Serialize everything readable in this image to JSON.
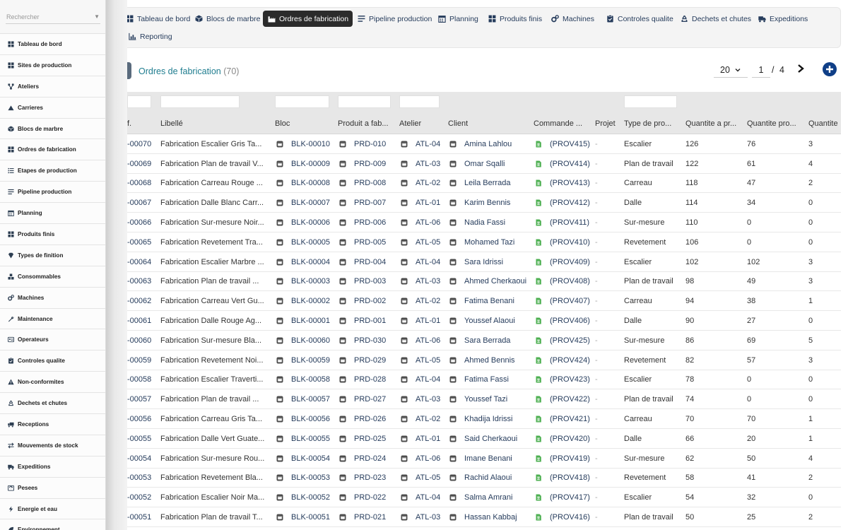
{
  "search": {
    "placeholder": "Rechercher"
  },
  "menu": [
    {
      "label": "Tableau de bord",
      "icon": "grid-icon"
    },
    {
      "label": "Sites de production",
      "icon": "grid-icon"
    },
    {
      "label": "Ateliers",
      "icon": "network-icon"
    },
    {
      "label": "Carrieres",
      "icon": "mountain-icon"
    },
    {
      "label": "Blocs de marbre",
      "icon": "cube-icon"
    },
    {
      "label": "Ordres de fabrication",
      "icon": "grid-icon"
    },
    {
      "label": "Etapes de production",
      "icon": "list-icon"
    },
    {
      "label": "Pipeline production",
      "icon": "lines-icon"
    },
    {
      "label": "Planning",
      "icon": "calendar-icon"
    },
    {
      "label": "Produits finis",
      "icon": "grid-icon"
    },
    {
      "label": "Types de finition",
      "icon": "gem-icon"
    },
    {
      "label": "Consommables",
      "icon": "boxes-icon"
    },
    {
      "label": "Machines",
      "icon": "cogs-icon"
    },
    {
      "label": "Maintenance",
      "icon": "wrench-icon"
    },
    {
      "label": "Operateurs",
      "icon": "id-card-icon"
    },
    {
      "label": "Controles qualite",
      "icon": "clipboard-check-icon"
    },
    {
      "label": "Non-conformites",
      "icon": "warning-icon"
    },
    {
      "label": "Dechets et chutes",
      "icon": "recycle-icon"
    },
    {
      "label": "Receptions",
      "icon": "truck-loading-icon"
    },
    {
      "label": "Mouvements de stock",
      "icon": "exchange-icon"
    },
    {
      "label": "Expeditions",
      "icon": "truck-icon"
    },
    {
      "label": "Pesees",
      "icon": "scale-icon"
    },
    {
      "label": "Energie et eau",
      "icon": "bolt-icon"
    },
    {
      "label": "Environnement",
      "icon": "leaf-icon"
    }
  ],
  "tabs": [
    {
      "label": "Tableau de bord",
      "icon": "grid-icon"
    },
    {
      "label": "Blocs de marbre",
      "icon": "cube-icon"
    },
    {
      "label": "Ordres de fabrication",
      "icon": "industry-icon",
      "active": true
    },
    {
      "label": "Pipeline production",
      "icon": "lines-icon"
    },
    {
      "label": "Planning",
      "icon": "calendar-icon"
    },
    {
      "label": "Produits finis",
      "icon": "grid-icon"
    },
    {
      "label": "Machines",
      "icon": "cogs-icon"
    },
    {
      "label": "Controles qualite",
      "icon": "clipboard-check-icon"
    },
    {
      "label": "Dechets et chutes",
      "icon": "recycle-icon"
    },
    {
      "label": "Expeditions",
      "icon": "truck-icon"
    },
    {
      "label": "Reporting",
      "icon": "chart-icon"
    }
  ],
  "title": {
    "label": "Ordres de fabrication",
    "count": "(70)"
  },
  "pagination": {
    "page_size": "20",
    "page": "1",
    "separator": "/",
    "total": "4"
  },
  "table": {
    "columns": [
      "f.",
      "Libellé",
      "Bloc",
      "Produit a fab...",
      "Atelier",
      "Client",
      "Commande ...",
      "Projet",
      "Type de pro...",
      "Quantite a pr...",
      "Quantite pro...",
      "Quantite"
    ],
    "rows": [
      [
        "-00070",
        "Fabrication Escalier Gris Ta...",
        "BLK-00010",
        "PRD-010",
        "ATL-04",
        "Amina Lahlou",
        "(PROV415)",
        "-",
        "Escalier",
        "126",
        "76",
        "3"
      ],
      [
        "-00069",
        "Fabrication Plan de travail V...",
        "BLK-00009",
        "PRD-009",
        "ATL-03",
        "Omar Sqalli",
        "(PROV414)",
        "-",
        "Plan de travail",
        "122",
        "61",
        "4"
      ],
      [
        "-00068",
        "Fabrication Carreau Rouge ...",
        "BLK-00008",
        "PRD-008",
        "ATL-02",
        "Leila Berrada",
        "(PROV413)",
        "-",
        "Carreau",
        "118",
        "47",
        "2"
      ],
      [
        "-00067",
        "Fabrication Dalle Blanc Carr...",
        "BLK-00007",
        "PRD-007",
        "ATL-01",
        "Karim Bennis",
        "(PROV412)",
        "-",
        "Dalle",
        "114",
        "34",
        "0"
      ],
      [
        "-00066",
        "Fabrication Sur-mesure Noir...",
        "BLK-00006",
        "PRD-006",
        "ATL-06",
        "Nadia Fassi",
        "(PROV411)",
        "-",
        "Sur-mesure",
        "110",
        "0",
        "0"
      ],
      [
        "-00065",
        "Fabrication Revetement Tra...",
        "BLK-00005",
        "PRD-005",
        "ATL-05",
        "Mohamed Tazi",
        "(PROV410)",
        "-",
        "Revetement",
        "106",
        "0",
        "0"
      ],
      [
        "-00064",
        "Fabrication Escalier Marbre ...",
        "BLK-00004",
        "PRD-004",
        "ATL-04",
        "Sara Idrissi",
        "(PROV409)",
        "-",
        "Escalier",
        "102",
        "102",
        "3"
      ],
      [
        "-00063",
        "Fabrication Plan de travail ...",
        "BLK-00003",
        "PRD-003",
        "ATL-03",
        "Ahmed Cherkaoui",
        "(PROV408)",
        "-",
        "Plan de travail",
        "98",
        "49",
        "3"
      ],
      [
        "-00062",
        "Fabrication Carreau Vert Gu...",
        "BLK-00002",
        "PRD-002",
        "ATL-02",
        "Fatima Benani",
        "(PROV407)",
        "-",
        "Carreau",
        "94",
        "38",
        "1"
      ],
      [
        "-00061",
        "Fabrication Dalle Rouge Ag...",
        "BLK-00001",
        "PRD-001",
        "ATL-01",
        "Youssef Alaoui",
        "(PROV406)",
        "-",
        "Dalle",
        "90",
        "27",
        "0"
      ],
      [
        "-00060",
        "Fabrication Sur-mesure Bla...",
        "BLK-00060",
        "PRD-030",
        "ATL-06",
        "Sara Berrada",
        "(PROV425)",
        "-",
        "Sur-mesure",
        "86",
        "69",
        "5"
      ],
      [
        "-00059",
        "Fabrication Revetement Noi...",
        "BLK-00059",
        "PRD-029",
        "ATL-05",
        "Ahmed Bennis",
        "(PROV424)",
        "-",
        "Revetement",
        "82",
        "57",
        "3"
      ],
      [
        "-00058",
        "Fabrication Escalier Traverti...",
        "BLK-00058",
        "PRD-028",
        "ATL-04",
        "Fatima Fassi",
        "(PROV423)",
        "-",
        "Escalier",
        "78",
        "0",
        "0"
      ],
      [
        "-00057",
        "Fabrication Plan de travail ...",
        "BLK-00057",
        "PRD-027",
        "ATL-03",
        "Youssef Tazi",
        "(PROV422)",
        "-",
        "Plan de travail",
        "74",
        "0",
        "0"
      ],
      [
        "-00056",
        "Fabrication Carreau Gris Ta...",
        "BLK-00056",
        "PRD-026",
        "ATL-02",
        "Khadija Idrissi",
        "(PROV421)",
        "-",
        "Carreau",
        "70",
        "70",
        "1"
      ],
      [
        "-00055",
        "Fabrication Dalle Vert Guate...",
        "BLK-00055",
        "PRD-025",
        "ATL-01",
        "Said Cherkaoui",
        "(PROV420)",
        "-",
        "Dalle",
        "66",
        "20",
        "1"
      ],
      [
        "-00054",
        "Fabrication Sur-mesure Rou...",
        "BLK-00054",
        "PRD-024",
        "ATL-06",
        "Imane Benani",
        "(PROV419)",
        "-",
        "Sur-mesure",
        "62",
        "50",
        "4"
      ],
      [
        "-00053",
        "Fabrication Revetement Bla...",
        "BLK-00053",
        "PRD-023",
        "ATL-05",
        "Rachid Alaoui",
        "(PROV418)",
        "-",
        "Revetement",
        "58",
        "41",
        "2"
      ],
      [
        "-00052",
        "Fabrication Escalier Noir Ma...",
        "BLK-00052",
        "PRD-022",
        "ATL-04",
        "Salma Amrani",
        "(PROV417)",
        "-",
        "Escalier",
        "54",
        "32",
        "0"
      ],
      [
        "-00051",
        "Fabrication Plan de travail T...",
        "BLK-00051",
        "PRD-021",
        "ATL-03",
        "Hassan Kabbaj",
        "(PROV416)",
        "-",
        "Plan de travail",
        "50",
        "25",
        "2"
      ]
    ]
  },
  "colors": {
    "accent": "#1f7d8f",
    "link": "#263c5c",
    "add_button": "#0f3f87",
    "active_tab": "#2b2b2b",
    "order_icon": "#4caf50"
  }
}
